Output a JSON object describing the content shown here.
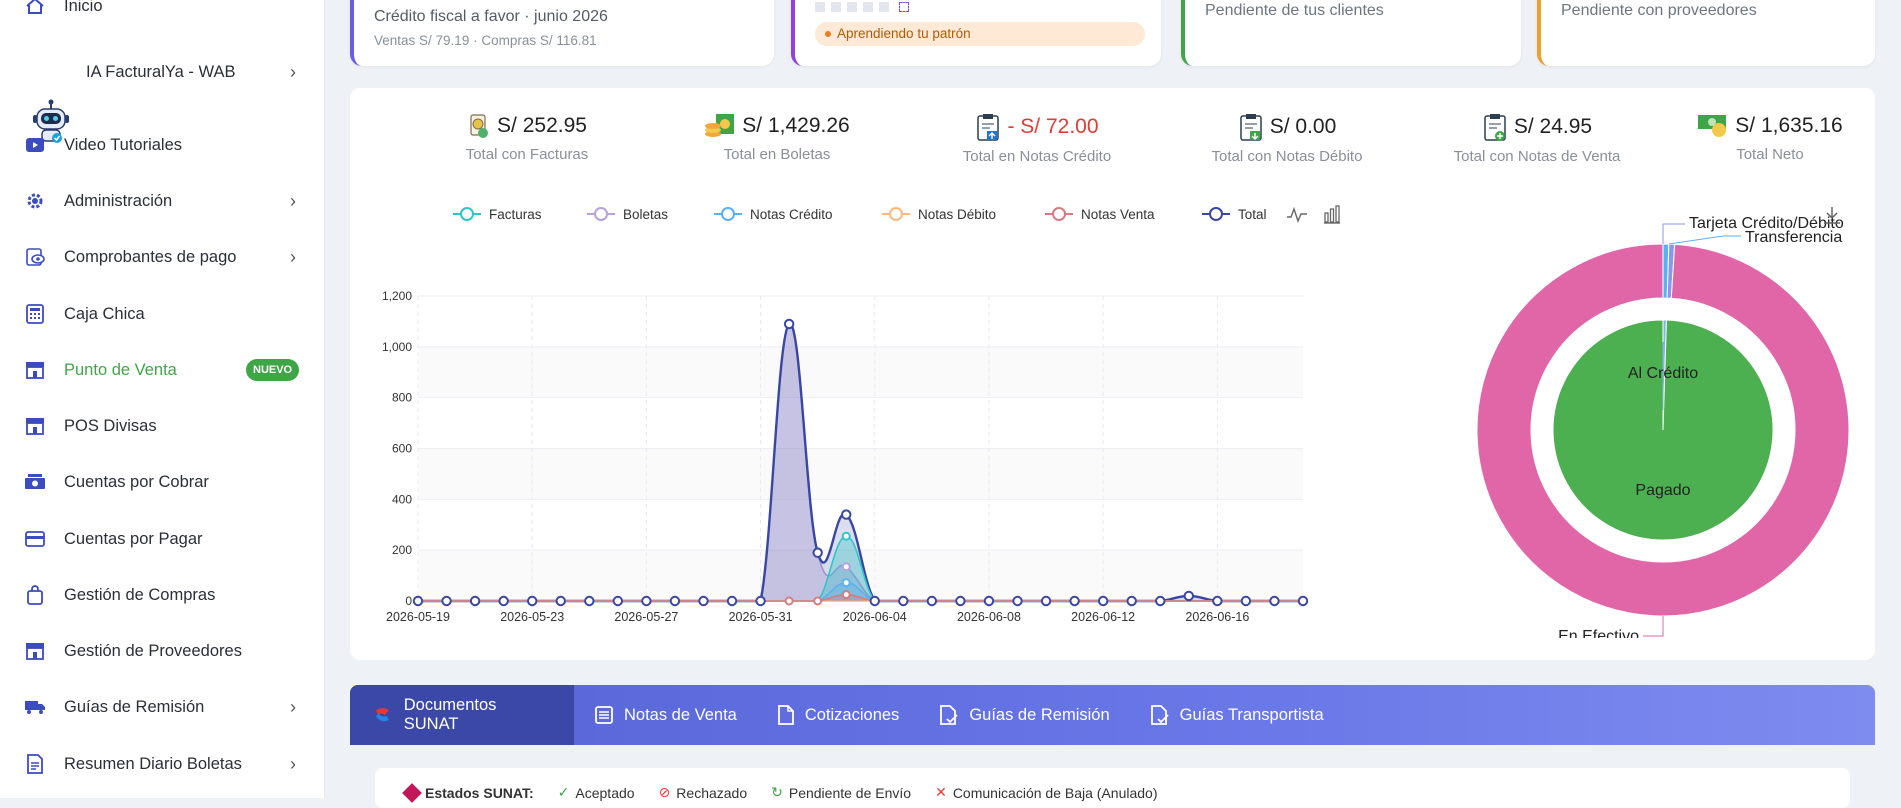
{
  "sidebar": {
    "top_label": "Inicio",
    "items": [
      {
        "label": "IA FacturalYa - WAB",
        "icon": "robot-icon",
        "chevron": true
      },
      {
        "label": "Video Tutoriales",
        "icon": "video-icon",
        "chevron": false
      },
      {
        "label": "Administración",
        "icon": "gear-icon",
        "chevron": true
      },
      {
        "label": "Comprobantes de pago",
        "icon": "eye-icon",
        "chevron": true
      },
      {
        "label": "Caja Chica",
        "icon": "calculator-icon",
        "chevron": false
      },
      {
        "label": "Punto de Venta",
        "icon": "store-icon",
        "chevron": false,
        "badge": "NUEVO",
        "active": true
      },
      {
        "label": "POS Divisas",
        "icon": "store-icon",
        "chevron": false
      },
      {
        "label": "Cuentas por Cobrar",
        "icon": "cash-icon",
        "chevron": false
      },
      {
        "label": "Cuentas por Pagar",
        "icon": "credit-card-icon",
        "chevron": false
      },
      {
        "label": "Gestión de Compras",
        "icon": "bag-icon",
        "chevron": false
      },
      {
        "label": "Gestión de Proveedores",
        "icon": "store-icon",
        "chevron": false
      },
      {
        "label": "Guías de Remisión",
        "icon": "truck-icon",
        "chevron": true
      },
      {
        "label": "Resumen Diario Boletas",
        "icon": "document-icon",
        "chevron": true
      }
    ]
  },
  "top_cards": [
    {
      "line1": "Crédito fiscal a favor · junio 2026",
      "line2": "Ventas S/ 79.19 · Compras S/ 116.81",
      "accent": "#6b5ce7"
    },
    {
      "pill": "Aprendiendo tu patrón",
      "accent": "#8e44d8"
    },
    {
      "line1": "Pendiente de tus clientes",
      "accent": "#3fa647"
    },
    {
      "line1": "Pendiente con proveedores",
      "accent": "#f0a030"
    }
  ],
  "totals": [
    {
      "value": "S/ 252.95",
      "label": "Total con Facturas",
      "icon": "receipt-icon"
    },
    {
      "value": "S/ 1,429.26",
      "label": "Total en Boletas",
      "icon": "coins-icon"
    },
    {
      "value": "- S/ 72.00",
      "label": "Total en Notas Crédito",
      "icon": "clipboard-icon",
      "negative": true
    },
    {
      "value": "S/ 0.00",
      "label": "Total con Notas Débito",
      "icon": "clipboard-icon"
    },
    {
      "value": "S/ 24.95",
      "label": "Total con Notas de Venta",
      "icon": "clipboard-icon"
    },
    {
      "value": "S/ 1,635.16",
      "label": "Total Neto",
      "icon": "money-icon"
    }
  ],
  "chart_data": [
    {
      "type": "area",
      "x": [
        "2026-05-19",
        "2026-05-20",
        "2026-05-21",
        "2026-05-22",
        "2026-05-23",
        "2026-05-24",
        "2026-05-25",
        "2026-05-26",
        "2026-05-27",
        "2026-05-28",
        "2026-05-29",
        "2026-05-30",
        "2026-05-31",
        "2026-06-01",
        "2026-06-02",
        "2026-06-03",
        "2026-06-04",
        "2026-06-05",
        "2026-06-06",
        "2026-06-07",
        "2026-06-08",
        "2026-06-09",
        "2026-06-10",
        "2026-06-11",
        "2026-06-12",
        "2026-06-13",
        "2026-06-14",
        "2026-06-15",
        "2026-06-16",
        "2026-06-17",
        "2026-06-18",
        "2026-06-19"
      ],
      "x_tick_labels": [
        "2026-05-19",
        "2026-05-23",
        "2026-05-27",
        "2026-05-31",
        "2026-06-04",
        "2026-06-08",
        "2026-06-12",
        "2026-06-16"
      ],
      "ylim": [
        0,
        1200
      ],
      "y_ticks": [
        "0",
        "200",
        "400",
        "600",
        "800",
        "1,000",
        "1,200"
      ],
      "grid": true,
      "legend_position": "top",
      "series": [
        {
          "name": "Facturas",
          "color": "#2ec7c9",
          "values": [
            0,
            0,
            0,
            0,
            0,
            0,
            0,
            0,
            0,
            0,
            0,
            0,
            0,
            0,
            0,
            255,
            0,
            0,
            0,
            0,
            0,
            0,
            0,
            0,
            0,
            0,
            0,
            0,
            0,
            0,
            0,
            0
          ]
        },
        {
          "name": "Boletas",
          "color": "#b6a2de",
          "values": [
            0,
            0,
            0,
            0,
            0,
            0,
            0,
            0,
            0,
            0,
            0,
            0,
            0,
            1090,
            190,
            135,
            0,
            0,
            0,
            0,
            0,
            0,
            0,
            0,
            0,
            0,
            0,
            0,
            0,
            0,
            0,
            0
          ]
        },
        {
          "name": "Notas Crédito",
          "color": "#5ab1ef",
          "values": [
            0,
            0,
            0,
            0,
            0,
            0,
            0,
            0,
            0,
            0,
            0,
            0,
            0,
            0,
            0,
            72,
            0,
            0,
            0,
            0,
            0,
            0,
            0,
            0,
            0,
            0,
            0,
            0,
            0,
            0,
            0,
            0
          ]
        },
        {
          "name": "Notas Débito",
          "color": "#ffb980",
          "values": [
            0,
            0,
            0,
            0,
            0,
            0,
            0,
            0,
            0,
            0,
            0,
            0,
            0,
            0,
            0,
            0,
            0,
            0,
            0,
            0,
            0,
            0,
            0,
            0,
            0,
            0,
            0,
            0,
            0,
            0,
            0,
            0
          ]
        },
        {
          "name": "Notas Venta",
          "color": "#d87a80",
          "values": [
            0,
            0,
            0,
            0,
            0,
            0,
            0,
            0,
            0,
            0,
            0,
            0,
            0,
            0,
            0,
            25,
            0,
            0,
            0,
            0,
            0,
            0,
            0,
            0,
            0,
            0,
            0,
            0,
            0,
            0,
            0,
            0
          ]
        },
        {
          "name": "Total",
          "color": "#3a46a3",
          "values": [
            0,
            0,
            0,
            0,
            0,
            0,
            0,
            0,
            0,
            0,
            0,
            0,
            0,
            1090,
            190,
            340,
            0,
            0,
            0,
            0,
            0,
            0,
            0,
            0,
            0,
            0,
            0,
            20,
            0,
            0,
            0,
            0
          ]
        }
      ]
    },
    {
      "type": "pie",
      "outer": [
        {
          "name": "En Efectivo",
          "value": 99,
          "color": "#e066a8"
        },
        {
          "name": "Tarjeta Crédito/Débito",
          "value": 0.5,
          "color": "#8a9ae8"
        },
        {
          "name": "Transferencia",
          "value": 0.5,
          "color": "#5ab1ef"
        }
      ],
      "inner": [
        {
          "name": "Al Crédito",
          "value": 0.5,
          "color": "#7bb8e0"
        },
        {
          "name": "Pagado",
          "value": 99.5,
          "color": "#4caf50"
        }
      ]
    }
  ],
  "chart_toolbar": {
    "line_icon": "line-chart-icon",
    "bar_icon": "bar-chart-icon",
    "download_icon": "download-icon"
  },
  "tabs": [
    {
      "label": "Documentos SUNAT",
      "icon": "sunat-icon",
      "active": true
    },
    {
      "label": "Notas de Venta",
      "icon": "list-icon"
    },
    {
      "label": "Cotizaciones",
      "icon": "file-icon"
    },
    {
      "label": "Guías de Remisión",
      "icon": "file-check-icon"
    },
    {
      "label": "Guías Transportista",
      "icon": "file-check-icon"
    }
  ],
  "status_row": {
    "title": "Estados SUNAT:",
    "items": [
      "Aceptado",
      "Rechazado",
      "Pendiente de Envío",
      "Comunicación de Baja (Anulado)"
    ]
  }
}
